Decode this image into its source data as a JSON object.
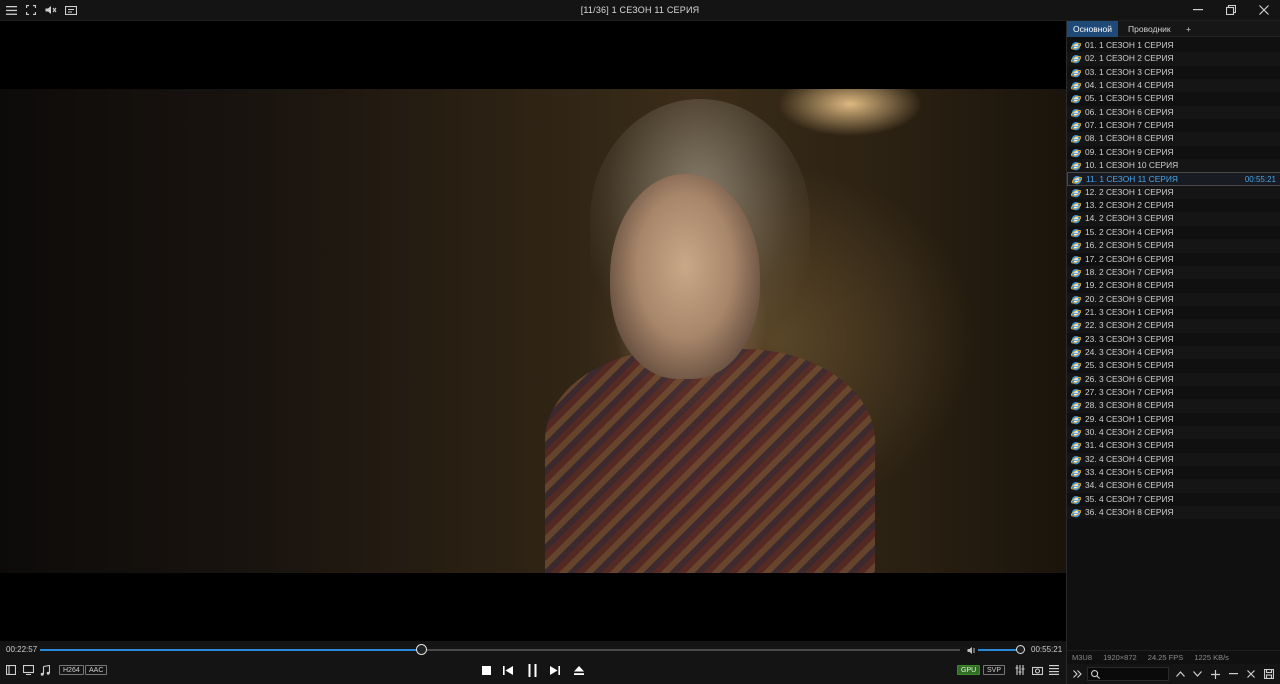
{
  "window": {
    "title": "[11/36]  1 СЕЗОН 11 СЕРИЯ",
    "toolbar_icons": [
      "menu-icon",
      "fullscreen-icon",
      "audio-icon",
      "subtitle-icon"
    ],
    "win_buttons": [
      "minimize-icon",
      "restore-icon",
      "close-icon"
    ]
  },
  "player": {
    "elapsed": "00:22:57",
    "total": "00:55:21",
    "progress_fraction": 0.415,
    "volume_fraction": 1.0,
    "codec_tags": [
      "H264",
      "AAC"
    ],
    "render_tags": [
      "GPU",
      "SVP"
    ],
    "accent_color": "#2b8ad8"
  },
  "playlist": {
    "tabs": [
      {
        "label": "Основной",
        "active": true
      },
      {
        "label": "Проводник",
        "active": false
      },
      {
        "label": "+",
        "active": false
      }
    ],
    "current_index": 10,
    "current_duration": "00:55:21",
    "items": [
      "01.  1 СЕЗОН 1 СЕРИЯ",
      "02.  1 СЕЗОН 2 СЕРИЯ",
      "03.  1 СЕЗОН 3 СЕРИЯ",
      "04.  1 СЕЗОН 4 СЕРИЯ",
      "05.  1 СЕЗОН 5 СЕРИЯ",
      "06.  1 СЕЗОН 6 СЕРИЯ",
      "07.  1 СЕЗОН 7 СЕРИЯ",
      "08.  1 СЕЗОН 8 СЕРИЯ",
      "09.  1 СЕЗОН 9 СЕРИЯ",
      "10.  1 СЕЗОН 10 СЕРИЯ",
      "11.  1 СЕЗОН 11 СЕРИЯ",
      "12.  2 СЕЗОН 1 СЕРИЯ",
      "13.  2 СЕЗОН 2 СЕРИЯ",
      "14.  2 СЕЗОН 3 СЕРИЯ",
      "15.  2 СЕЗОН 4 СЕРИЯ",
      "16.  2 СЕЗОН 5 СЕРИЯ",
      "17.  2 СЕЗОН 6 СЕРИЯ",
      "18.  2 СЕЗОН 7 СЕРИЯ",
      "19.  2 СЕЗОН 8 СЕРИЯ",
      "20.  2 СЕЗОН 9 СЕРИЯ",
      "21.  3 СЕЗОН 1 СЕРИЯ",
      "22.  3 СЕЗОН 2 СЕРИЯ",
      "23.  3 СЕЗОН 3 СЕРИЯ",
      "24.  3 СЕЗОН 4 СЕРИЯ",
      "25.  3 СЕЗОН 5 СЕРИЯ",
      "26.  3 СЕЗОН 6 СЕРИЯ",
      "27.  3 СЕЗОН 7 СЕРИЯ",
      "28.  3 СЕЗОН 8 СЕРИЯ",
      "29.  4 СЕЗОН 1 СЕРИЯ",
      "30.  4 СЕЗОН 2 СЕРИЯ",
      "31.  4 СЕЗОН 3 СЕРИЯ",
      "32.  4 СЕЗОН 4 СЕРИЯ",
      "33.  4 СЕЗОН 5 СЕРИЯ",
      "34.  4 СЕЗОН 6 СЕРИЯ",
      "35.  4 СЕЗОН 7 СЕРИЯ",
      "36.  4 СЕЗОН 8 СЕРИЯ"
    ],
    "status": {
      "format": "M3U8",
      "resolution": "1920×872",
      "fps": "24.25 FPS",
      "bitrate": "1225 KB/s"
    }
  }
}
